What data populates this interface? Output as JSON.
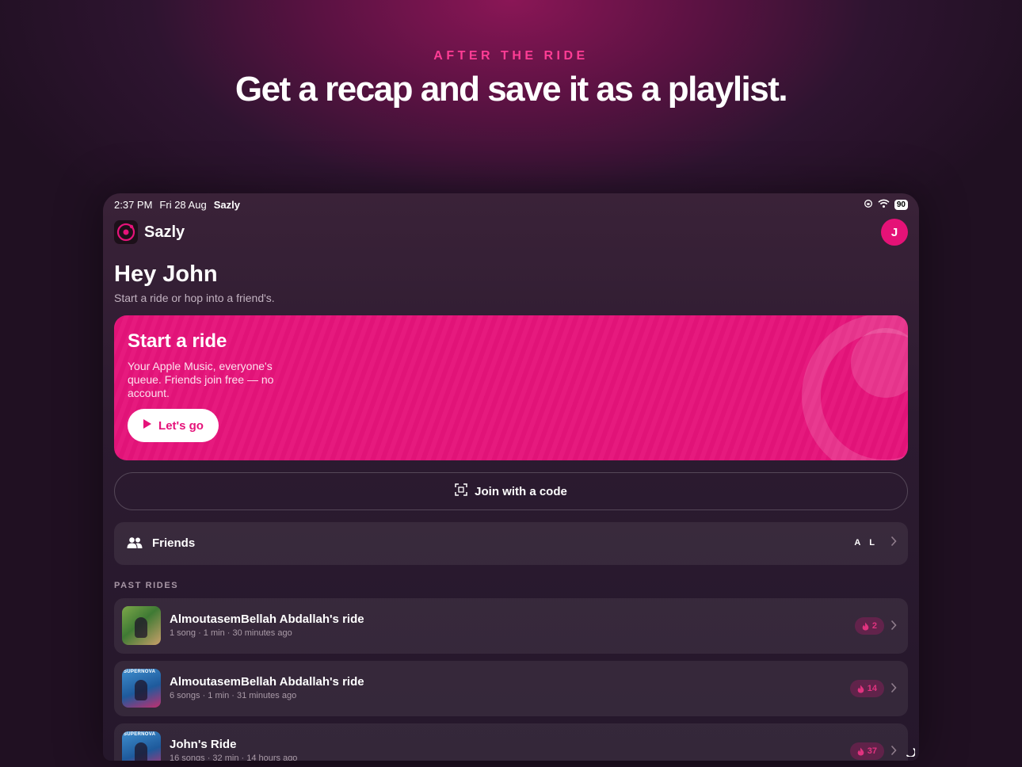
{
  "promo": {
    "eyebrow": "AFTER THE RIDE",
    "headline": "Get a recap and save it as a playlist."
  },
  "status_bar": {
    "time": "2:37 PM",
    "date": "Fri 28 Aug",
    "app": "Sazly",
    "battery": "90"
  },
  "header": {
    "app_name": "Sazly",
    "avatar_initial": "J"
  },
  "greeting": {
    "title": "Hey John",
    "subtitle": "Start a ride or hop into a friend's."
  },
  "hero": {
    "title": "Start a ride",
    "description": "Your Apple Music, everyone's queue. Friends join free — no account.",
    "button_label": "Let's go"
  },
  "join": {
    "label": "Join with a code"
  },
  "friends": {
    "label": "Friends",
    "initials": [
      "A",
      "L"
    ]
  },
  "past_rides": {
    "section_label": "PAST RIDES",
    "items": [
      {
        "title": "AlmoutasemBellah Abdallah's ride",
        "meta": "1 song · 1 min · 30 minutes ago",
        "badge": "2"
      },
      {
        "title": "AlmoutasemBellah Abdallah's ride",
        "meta": "6 songs · 1 min · 31 minutes ago",
        "badge": "14"
      },
      {
        "title": "John's Ride",
        "meta": "16 songs · 32 min · 14 hours ago",
        "badge": "37"
      }
    ],
    "thumb_text": "SUPERNOVA"
  },
  "colors": {
    "accent": "#e5137a",
    "background": "#201022"
  }
}
